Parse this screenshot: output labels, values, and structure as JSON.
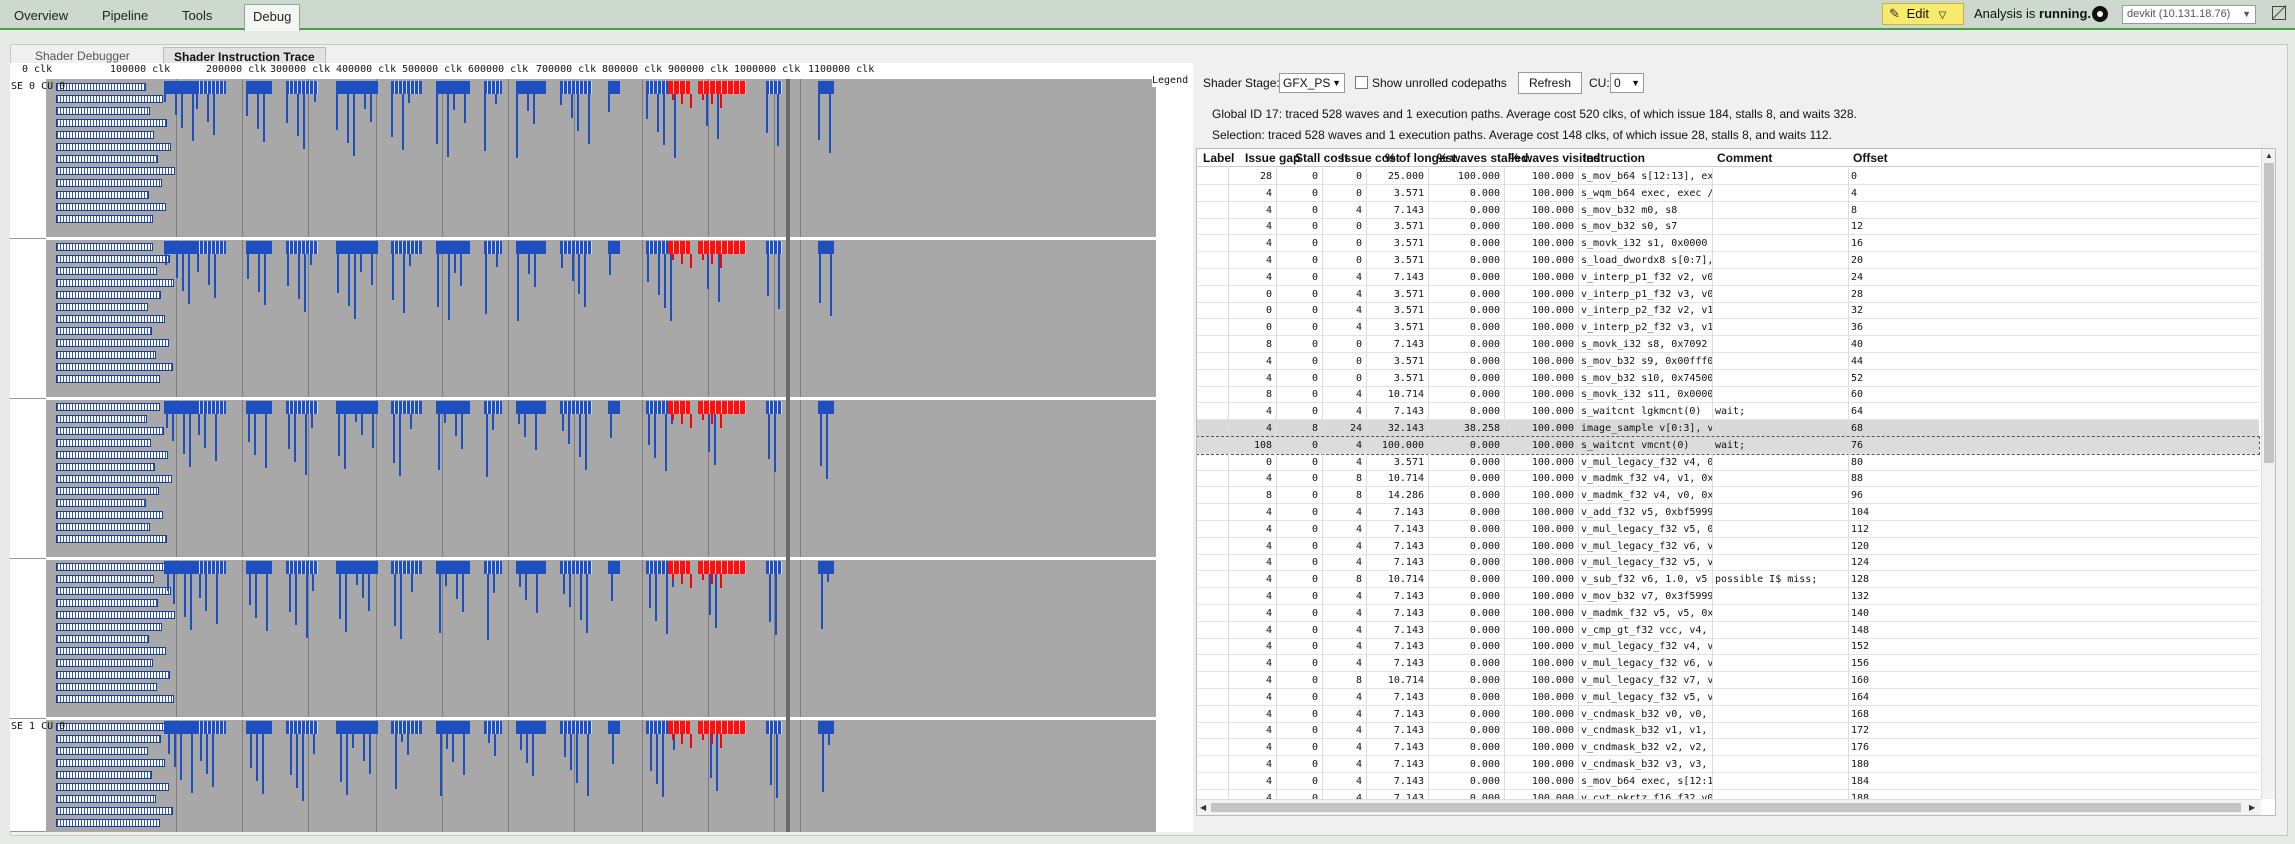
{
  "top_tabs": [
    "Overview",
    "Pipeline",
    "Tools",
    "Debug"
  ],
  "active_tab": "Debug",
  "edit_label": "Edit",
  "status_prefix": "Analysis is",
  "status_value": "running.",
  "device": "devkit (10.131.18.76)",
  "sub_tabs": [
    "Shader Debugger",
    "Shader Instruction Trace"
  ],
  "ruler_ticks": [
    "0 clk",
    "100000 clk",
    "200000 clk",
    "300000 clk",
    "400000 clk",
    "500000 clk",
    "600000 clk",
    "700000 clk",
    "800000 clk",
    "900000 clk",
    "1000000 clk",
    "1100000 clk"
  ],
  "band_labels": [
    "SE 0 CU 0",
    "SE 1 CU 0"
  ],
  "legend_label": "Legend",
  "controls": {
    "stage_label": "Shader Stage:",
    "stage_value": "GFX_PS",
    "unrolled_label": "Show unrolled codepaths",
    "refresh_label": "Refresh",
    "cu_label": "CU:",
    "cu_value": "0"
  },
  "global_info": "Global ID 17: traced 528 waves and 1 execution paths. Average cost 520 clks, of which issue 184, stalls 8, and waits 328.",
  "selection_info": "Selection: traced 528 waves and 1 execution paths. Average cost 148 clks, of which issue 28, stalls 8, and waits 112.",
  "columns": [
    "Label",
    "Issue gap",
    "Stall cost",
    "Issue cost",
    "% of longest",
    "% waves stalled",
    "% waves visited",
    "Instruction",
    "Comment",
    "Offset"
  ],
  "rows": [
    [
      "",
      "28",
      "0",
      "0",
      "25.000",
      "100.000",
      "100.000",
      "s_mov_b64     s[12:13], ex…",
      "",
      "0"
    ],
    [
      "",
      "4",
      "0",
      "0",
      "3.571",
      "0.000",
      "100.000",
      "s_wqm_b64     exec, exec /…",
      "",
      "4"
    ],
    [
      "",
      "4",
      "0",
      "4",
      "7.143",
      "0.000",
      "100.000",
      "s_mov_b32     m0, s8",
      "",
      "8"
    ],
    [
      "",
      "4",
      "0",
      "0",
      "3.571",
      "0.000",
      "100.000",
      "s_mov_b32     s0, s7",
      "",
      "12"
    ],
    [
      "",
      "4",
      "0",
      "0",
      "3.571",
      "0.000",
      "100.000",
      "s_movk_i32    s1, 0x0000",
      "",
      "16"
    ],
    [
      "",
      "4",
      "0",
      "0",
      "3.571",
      "0.000",
      "100.000",
      "s_load_dwordx8  s[0:7], s[…",
      "",
      "20"
    ],
    [
      "",
      "4",
      "0",
      "4",
      "7.143",
      "0.000",
      "100.000",
      "v_interp_p1_f32  v2, v0, a…",
      "",
      "24"
    ],
    [
      "",
      "0",
      "0",
      "4",
      "3.571",
      "0.000",
      "100.000",
      "v_interp_p1_f32  v3, v0, a…",
      "",
      "28"
    ],
    [
      "",
      "0",
      "0",
      "4",
      "3.571",
      "0.000",
      "100.000",
      "v_interp_p2_f32  v2, v1, a…",
      "",
      "32"
    ],
    [
      "",
      "0",
      "0",
      "4",
      "3.571",
      "0.000",
      "100.000",
      "v_interp_p2_f32  v3, v1, a…",
      "",
      "36"
    ],
    [
      "",
      "8",
      "0",
      "0",
      "7.143",
      "0.000",
      "100.000",
      "s_movk_i32    s8, 0x7092",
      "",
      "40"
    ],
    [
      "",
      "4",
      "0",
      "0",
      "3.571",
      "0.000",
      "100.000",
      "s_mov_b32     s9, 0x00fff0…",
      "",
      "44"
    ],
    [
      "",
      "4",
      "0",
      "0",
      "3.571",
      "0.000",
      "100.000",
      "s_mov_b32     s10, 0x74500…",
      "",
      "52"
    ],
    [
      "",
      "8",
      "0",
      "4",
      "10.714",
      "0.000",
      "100.000",
      "s_movk_i32    s11, 0x0000",
      "",
      "60"
    ],
    [
      "",
      "4",
      "0",
      "4",
      "7.143",
      "0.000",
      "100.000",
      "s_waitcnt     lgkmcnt(0)",
      "wait;",
      "64"
    ],
    [
      "",
      "4",
      "8",
      "24",
      "32.143",
      "38.258",
      "100.000",
      "image_sample  v[0:3], v[2:…",
      "",
      "68"
    ],
    [
      "",
      "108",
      "0",
      "4",
      "100.000",
      "0.000",
      "100.000",
      "s_waitcnt     vmcnt(0)",
      "wait;",
      "76"
    ],
    [
      "",
      "0",
      "0",
      "4",
      "3.571",
      "0.000",
      "100.000",
      "v_mul_legacy_f32  v4, 0x3d…",
      "",
      "80"
    ],
    [
      "",
      "4",
      "0",
      "8",
      "10.714",
      "0.000",
      "100.000",
      "v_madmk_f32   v4, v1, 0x3f…",
      "",
      "88"
    ],
    [
      "",
      "8",
      "0",
      "8",
      "14.286",
      "0.000",
      "100.000",
      "v_madmk_f32   v4, v0, 0x3e…",
      "",
      "96"
    ],
    [
      "",
      "4",
      "0",
      "4",
      "7.143",
      "0.000",
      "100.000",
      "v_add_f32     v5, 0xbf5999…",
      "",
      "104"
    ],
    [
      "",
      "4",
      "0",
      "4",
      "7.143",
      "0.000",
      "100.000",
      "v_mul_legacy_f32  v5, 0x40…",
      "",
      "112"
    ],
    [
      "",
      "4",
      "0",
      "4",
      "7.143",
      "0.000",
      "100.000",
      "v_mul_legacy_f32  v6, v5,…",
      "",
      "120"
    ],
    [
      "",
      "4",
      "0",
      "4",
      "7.143",
      "0.000",
      "100.000",
      "v_mul_legacy_f32  v5, v5,…",
      "",
      "124"
    ],
    [
      "",
      "4",
      "0",
      "8",
      "10.714",
      "0.000",
      "100.000",
      "v_sub_f32     v6, 1.0, v5",
      "possible I$ miss;",
      "128"
    ],
    [
      "",
      "4",
      "0",
      "4",
      "7.143",
      "0.000",
      "100.000",
      "v_mov_b32     v7, 0x3f5999…",
      "",
      "132"
    ],
    [
      "",
      "4",
      "0",
      "4",
      "7.143",
      "0.000",
      "100.000",
      "v_madmk_f32   v5, v5, 0x41…",
      "",
      "140"
    ],
    [
      "",
      "4",
      "0",
      "4",
      "7.143",
      "0.000",
      "100.000",
      "v_cmp_gt_f32  vcc, v4, v7",
      "",
      "148"
    ],
    [
      "",
      "4",
      "0",
      "4",
      "7.143",
      "0.000",
      "100.000",
      "v_mul_legacy_f32  v4, v0,…",
      "",
      "152"
    ],
    [
      "",
      "4",
      "0",
      "4",
      "7.143",
      "0.000",
      "100.000",
      "v_mul_legacy_f32  v6, v1,…",
      "",
      "156"
    ],
    [
      "",
      "4",
      "0",
      "8",
      "10.714",
      "0.000",
      "100.000",
      "v_mul_legacy_f32  v7, v2,…",
      "",
      "160"
    ],
    [
      "",
      "4",
      "0",
      "4",
      "7.143",
      "0.000",
      "100.000",
      "v_mul_legacy_f32  v5, v3,…",
      "",
      "164"
    ],
    [
      "",
      "4",
      "0",
      "4",
      "7.143",
      "0.000",
      "100.000",
      "v_cndmask_b32  v0, v0, v4,…",
      "",
      "168"
    ],
    [
      "",
      "4",
      "0",
      "4",
      "7.143",
      "0.000",
      "100.000",
      "v_cndmask_b32  v1, v1, v6,…",
      "",
      "172"
    ],
    [
      "",
      "4",
      "0",
      "4",
      "7.143",
      "0.000",
      "100.000",
      "v_cndmask_b32  v2, v2, v7,…",
      "",
      "176"
    ],
    [
      "",
      "4",
      "0",
      "4",
      "7.143",
      "0.000",
      "100.000",
      "v_cndmask_b32  v3, v3, v5,…",
      "",
      "180"
    ],
    [
      "",
      "4",
      "0",
      "4",
      "7.143",
      "0.000",
      "100.000",
      "s_mov_b64     exec, s[12:1…",
      "",
      "184"
    ],
    [
      "",
      "4",
      "0",
      "4",
      "7.143",
      "0.000",
      "100.000",
      "v_cvt_pkrtz_f16_f32  v0, v…",
      "",
      "188"
    ]
  ],
  "colors": {
    "wave_blue": "#1d4fc0",
    "stall_red": "#ff1010",
    "trace_bg": "#a8a8a8",
    "accent_green": "#4f9a4f",
    "edit_yellow": "#f8ea6c"
  }
}
